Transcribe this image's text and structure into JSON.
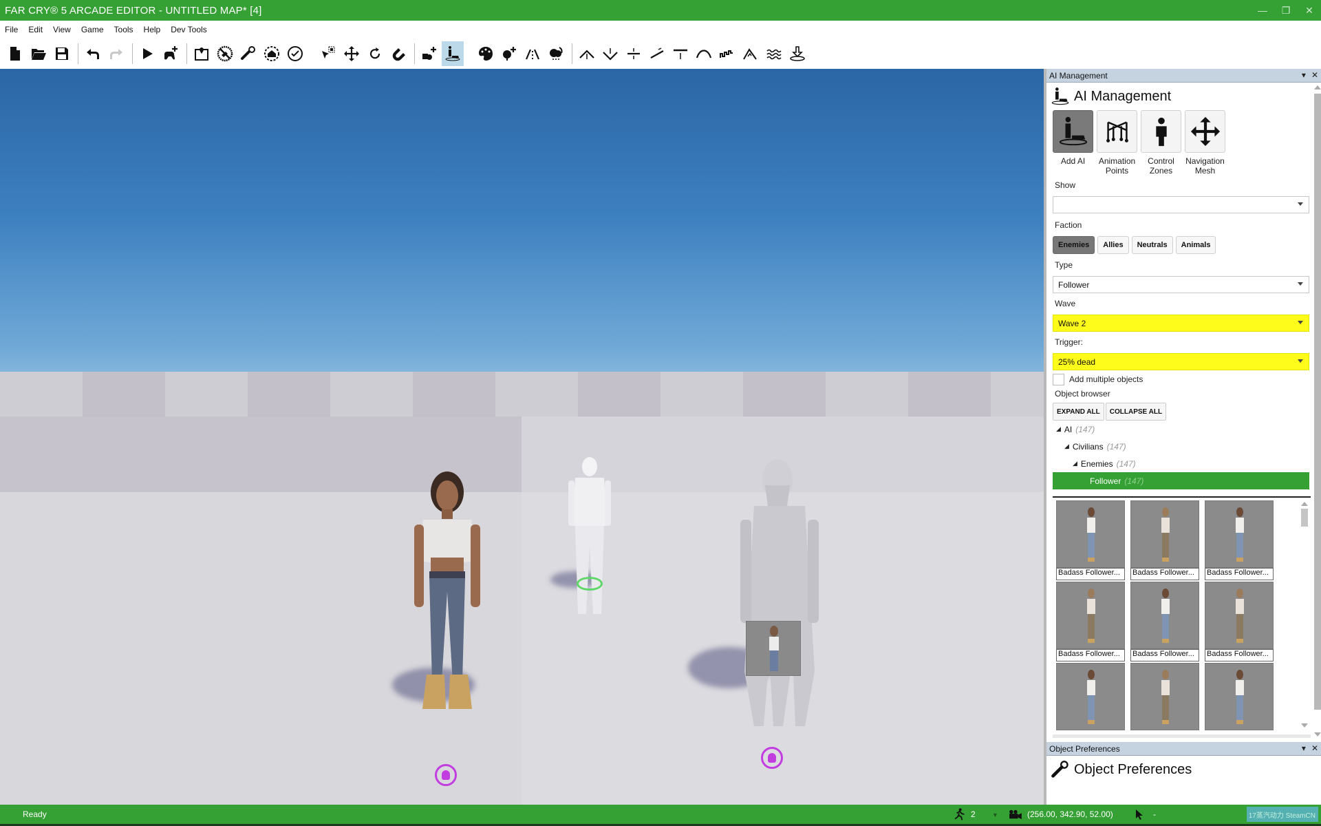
{
  "window": {
    "title": "FAR CRY® 5 ARCADE EDITOR - UNTITLED MAP* [4]",
    "controls": [
      "minimize",
      "restore",
      "close"
    ]
  },
  "menu": [
    "File",
    "Edit",
    "View",
    "Game",
    "Tools",
    "Help",
    "Dev Tools"
  ],
  "toolbar": {
    "groups": [
      [
        "new-file",
        "open-folder",
        "save"
      ],
      [
        "undo",
        "redo"
      ],
      [
        "play",
        "add-gamepad",
        "map-pin",
        "no-weapons",
        "wrench",
        "home-zone",
        "check-circle"
      ],
      [
        "select-cursor",
        "move-arrows",
        "rotate",
        "magnet"
      ],
      [
        "add-object",
        "ai-management"
      ],
      [
        "paint-palette",
        "add-tree",
        "road",
        "weather"
      ],
      [
        "terrain-raise",
        "terrain-lower",
        "terrain-flatten",
        "terrain-slope",
        "terrain-level",
        "terrain-smooth",
        "terrain-noise",
        "terrain-erode",
        "water",
        "terrain-stamp"
      ]
    ],
    "active": "ai-management"
  },
  "viewport": {
    "sky_top": "#2b66a6",
    "horizon": "#d6e6ee",
    "floor": "#cfcdd4",
    "entities": [
      {
        "name": "female-follower",
        "marker": "ai-marker",
        "marker_index": "1"
      },
      {
        "name": "white-male-placeholder",
        "marker": "player-spawn"
      },
      {
        "name": "bearded-male-follower",
        "marker": "ai-marker",
        "marker_index": "2"
      }
    ]
  },
  "ai_panel": {
    "dock_title": "AI Management",
    "title": "AI Management",
    "modes": [
      {
        "label_line1": "Add AI",
        "label_line2": "",
        "active": true
      },
      {
        "label_line1": "Animation",
        "label_line2": "Points",
        "active": false
      },
      {
        "label_line1": "Control",
        "label_line2": "Zones",
        "active": false
      },
      {
        "label_line1": "Navigation",
        "label_line2": "Mesh",
        "active": false
      }
    ],
    "show": {
      "label": "Show",
      "value": ""
    },
    "faction": {
      "label": "Faction",
      "options": [
        "Enemies",
        "Allies",
        "Neutrals",
        "Animals"
      ],
      "selected": "Enemies"
    },
    "type": {
      "label": "Type",
      "value": "Follower"
    },
    "wave": {
      "label": "Wave",
      "value": "Wave 2"
    },
    "trigger": {
      "label": "Trigger:",
      "value": "25% dead"
    },
    "add_multiple": {
      "label": "Add multiple objects",
      "checked": false
    },
    "object_browser": {
      "label": "Object browser",
      "expand_all": "EXPAND ALL",
      "collapse_all": "COLLAPSE ALL",
      "tree": [
        {
          "label": "AI",
          "count": "(147)",
          "level": 0
        },
        {
          "label": "Civilians",
          "count": "(147)",
          "level": 1
        },
        {
          "label": "Enemies",
          "count": "(147)",
          "level": 2
        },
        {
          "label": "Follower",
          "count": "(147)",
          "level": 3,
          "selected": true
        }
      ],
      "thumbnails": [
        {
          "caption": "Badass Follower...",
          "variant": "female"
        },
        {
          "caption": "Badass Follower...",
          "variant": "male"
        },
        {
          "caption": "Badass Follower...",
          "variant": "female"
        },
        {
          "caption": "Badass Follower...",
          "variant": "male"
        },
        {
          "caption": "Badass Follower...",
          "variant": "female"
        },
        {
          "caption": "Badass Follower...",
          "variant": "male"
        },
        {
          "caption": "",
          "variant": "female"
        },
        {
          "caption": "",
          "variant": "male"
        },
        {
          "caption": "",
          "variant": "female"
        }
      ]
    }
  },
  "object_prefs": {
    "dock_title": "Object Preferences",
    "title": "Object Preferences"
  },
  "statusbar": {
    "status": "Ready",
    "player_count": "2",
    "camera_coords": "(256.00, 342.90, 52.00)",
    "cursor_readout": "-",
    "watermark": "17蒸汽动力 SteamCN"
  },
  "colors": {
    "accent_green": "#35a033",
    "highlight_yellow": "#fefc1a",
    "marker_purple": "#c23de0",
    "spawn_green": "#5fd86a"
  }
}
